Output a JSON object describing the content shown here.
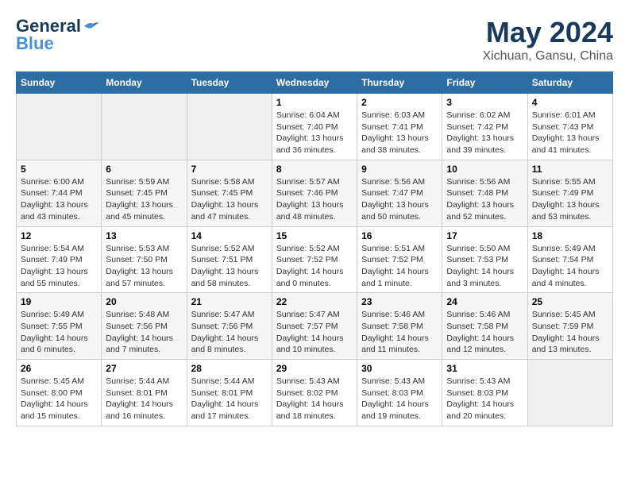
{
  "header": {
    "logo_line1": "General",
    "logo_line2": "Blue",
    "month": "May 2024",
    "location": "Xichuan, Gansu, China"
  },
  "weekdays": [
    "Sunday",
    "Monday",
    "Tuesday",
    "Wednesday",
    "Thursday",
    "Friday",
    "Saturday"
  ],
  "weeks": [
    [
      {
        "day": "",
        "info": ""
      },
      {
        "day": "",
        "info": ""
      },
      {
        "day": "",
        "info": ""
      },
      {
        "day": "1",
        "info": "Sunrise: 6:04 AM\nSunset: 7:40 PM\nDaylight: 13 hours\nand 36 minutes."
      },
      {
        "day": "2",
        "info": "Sunrise: 6:03 AM\nSunset: 7:41 PM\nDaylight: 13 hours\nand 38 minutes."
      },
      {
        "day": "3",
        "info": "Sunrise: 6:02 AM\nSunset: 7:42 PM\nDaylight: 13 hours\nand 39 minutes."
      },
      {
        "day": "4",
        "info": "Sunrise: 6:01 AM\nSunset: 7:43 PM\nDaylight: 13 hours\nand 41 minutes."
      }
    ],
    [
      {
        "day": "5",
        "info": "Sunrise: 6:00 AM\nSunset: 7:44 PM\nDaylight: 13 hours\nand 43 minutes."
      },
      {
        "day": "6",
        "info": "Sunrise: 5:59 AM\nSunset: 7:45 PM\nDaylight: 13 hours\nand 45 minutes."
      },
      {
        "day": "7",
        "info": "Sunrise: 5:58 AM\nSunset: 7:45 PM\nDaylight: 13 hours\nand 47 minutes."
      },
      {
        "day": "8",
        "info": "Sunrise: 5:57 AM\nSunset: 7:46 PM\nDaylight: 13 hours\nand 48 minutes."
      },
      {
        "day": "9",
        "info": "Sunrise: 5:56 AM\nSunset: 7:47 PM\nDaylight: 13 hours\nand 50 minutes."
      },
      {
        "day": "10",
        "info": "Sunrise: 5:56 AM\nSunset: 7:48 PM\nDaylight: 13 hours\nand 52 minutes."
      },
      {
        "day": "11",
        "info": "Sunrise: 5:55 AM\nSunset: 7:49 PM\nDaylight: 13 hours\nand 53 minutes."
      }
    ],
    [
      {
        "day": "12",
        "info": "Sunrise: 5:54 AM\nSunset: 7:49 PM\nDaylight: 13 hours\nand 55 minutes."
      },
      {
        "day": "13",
        "info": "Sunrise: 5:53 AM\nSunset: 7:50 PM\nDaylight: 13 hours\nand 57 minutes."
      },
      {
        "day": "14",
        "info": "Sunrise: 5:52 AM\nSunset: 7:51 PM\nDaylight: 13 hours\nand 58 minutes."
      },
      {
        "day": "15",
        "info": "Sunrise: 5:52 AM\nSunset: 7:52 PM\nDaylight: 14 hours\nand 0 minutes."
      },
      {
        "day": "16",
        "info": "Sunrise: 5:51 AM\nSunset: 7:52 PM\nDaylight: 14 hours\nand 1 minute."
      },
      {
        "day": "17",
        "info": "Sunrise: 5:50 AM\nSunset: 7:53 PM\nDaylight: 14 hours\nand 3 minutes."
      },
      {
        "day": "18",
        "info": "Sunrise: 5:49 AM\nSunset: 7:54 PM\nDaylight: 14 hours\nand 4 minutes."
      }
    ],
    [
      {
        "day": "19",
        "info": "Sunrise: 5:49 AM\nSunset: 7:55 PM\nDaylight: 14 hours\nand 6 minutes."
      },
      {
        "day": "20",
        "info": "Sunrise: 5:48 AM\nSunset: 7:56 PM\nDaylight: 14 hours\nand 7 minutes."
      },
      {
        "day": "21",
        "info": "Sunrise: 5:47 AM\nSunset: 7:56 PM\nDaylight: 14 hours\nand 8 minutes."
      },
      {
        "day": "22",
        "info": "Sunrise: 5:47 AM\nSunset: 7:57 PM\nDaylight: 14 hours\nand 10 minutes."
      },
      {
        "day": "23",
        "info": "Sunrise: 5:46 AM\nSunset: 7:58 PM\nDaylight: 14 hours\nand 11 minutes."
      },
      {
        "day": "24",
        "info": "Sunrise: 5:46 AM\nSunset: 7:58 PM\nDaylight: 14 hours\nand 12 minutes."
      },
      {
        "day": "25",
        "info": "Sunrise: 5:45 AM\nSunset: 7:59 PM\nDaylight: 14 hours\nand 13 minutes."
      }
    ],
    [
      {
        "day": "26",
        "info": "Sunrise: 5:45 AM\nSunset: 8:00 PM\nDaylight: 14 hours\nand 15 minutes."
      },
      {
        "day": "27",
        "info": "Sunrise: 5:44 AM\nSunset: 8:01 PM\nDaylight: 14 hours\nand 16 minutes."
      },
      {
        "day": "28",
        "info": "Sunrise: 5:44 AM\nSunset: 8:01 PM\nDaylight: 14 hours\nand 17 minutes."
      },
      {
        "day": "29",
        "info": "Sunrise: 5:43 AM\nSunset: 8:02 PM\nDaylight: 14 hours\nand 18 minutes."
      },
      {
        "day": "30",
        "info": "Sunrise: 5:43 AM\nSunset: 8:03 PM\nDaylight: 14 hours\nand 19 minutes."
      },
      {
        "day": "31",
        "info": "Sunrise: 5:43 AM\nSunset: 8:03 PM\nDaylight: 14 hours\nand 20 minutes."
      },
      {
        "day": "",
        "info": ""
      }
    ]
  ]
}
